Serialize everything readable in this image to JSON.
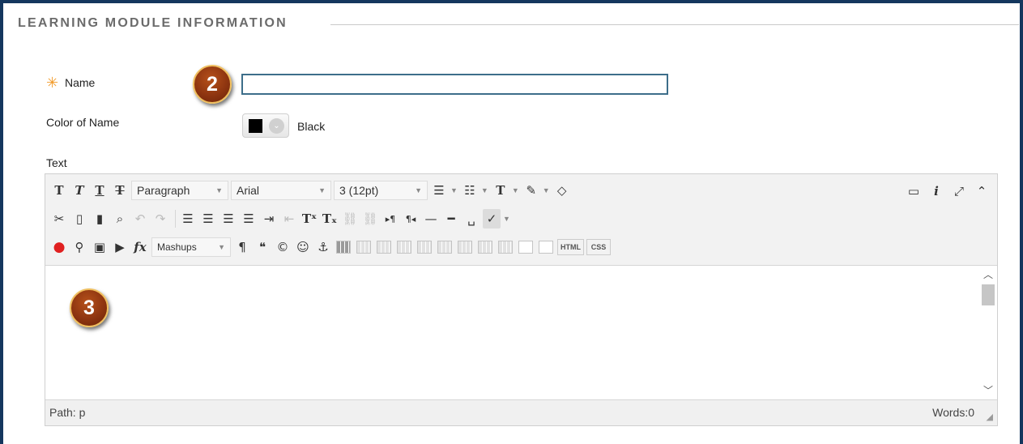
{
  "section": {
    "title": "LEARNING MODULE INFORMATION"
  },
  "form": {
    "name_label": "Name",
    "required_marker": "✳",
    "name_value": "",
    "color_label": "Color of Name",
    "color_value": "Black",
    "color_hex": "#000000",
    "text_label": "Text"
  },
  "badges": {
    "step2": "2",
    "step3": "3"
  },
  "toolbar": {
    "paragraph": "Paragraph",
    "font": "Arial",
    "size": "3 (12pt)",
    "mashups": "Mashups",
    "html": "HTML",
    "css": "CSS"
  },
  "editor": {
    "content": "",
    "path": "Path: p",
    "words": "Words:0"
  },
  "colors": {
    "frame": "#14375e",
    "input_border": "#3d6e8a",
    "star": "#f29b2a",
    "badge": "#8e3510"
  }
}
